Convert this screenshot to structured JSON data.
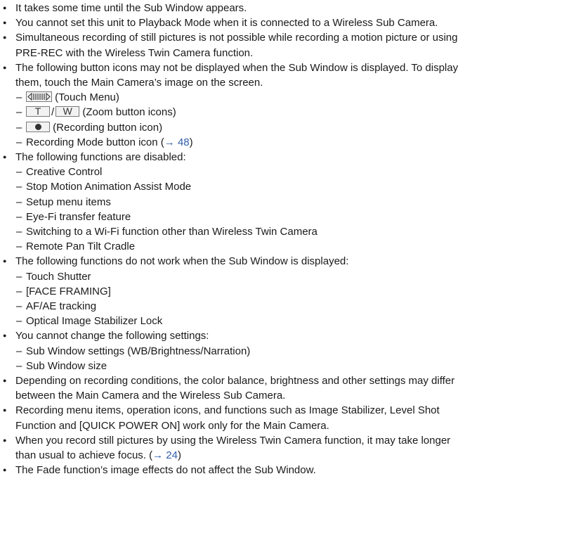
{
  "bullets": [
    {
      "text": "It takes some time until the Sub Window appears."
    },
    {
      "text": "You cannot set this unit to Playback Mode when it is connected to a Wireless Sub Camera."
    },
    {
      "line1": "Simultaneous recording of still pictures is not possible while recording a motion picture or using",
      "line2": "PRE-REC with the Wireless Twin Camera function."
    },
    {
      "line1": "The following button icons may not be displayed when the Sub Window is displayed. To display",
      "line2": "them, touch the Main Camera’s image on the screen."
    },
    {
      "text": "The following functions are disabled:"
    },
    {
      "text": "The following functions do not work when the Sub Window is displayed:"
    },
    {
      "text": "You cannot change the following settings:"
    },
    {
      "line1": "Depending on recording conditions, the color balance, brightness and other settings may differ",
      "line2": "between the Main Camera and the Wireless Sub Camera."
    },
    {
      "line1": "Recording menu items, operation icons, and functions such as Image Stabilizer, Level Shot",
      "line2": "Function and [QUICK POWER ON] work only for the Main Camera."
    },
    {
      "line1": "When you record still pictures by using the Wireless Twin Camera function, it may take longer",
      "line2": "than usual to achieve focus. (",
      "ref": "→ 24",
      "after": ")"
    },
    {
      "text": "The Fade function’s image effects do not affect the Sub Window."
    }
  ],
  "button_icons": {
    "touch_menu_label": "(Touch Menu)",
    "zoom_t": "T",
    "slash": "/",
    "zoom_w": "W",
    "zoom_label": "(Zoom button icons)",
    "recording_label": "(Recording button icon)",
    "rec_mode_text": "Recording Mode button icon (",
    "rec_mode_ref": "→ 48",
    "rec_mode_after": ")"
  },
  "disabled_functions": [
    "Creative Control",
    "Stop Motion Animation Assist Mode",
    "Setup menu items",
    "Eye-Fi transfer feature",
    "Switching to a Wi-Fi function other than Wireless Twin Camera",
    "Remote Pan Tilt Cradle"
  ],
  "not_working_functions": [
    "Touch Shutter",
    "[FACE FRAMING]",
    "AF/AE tracking",
    "Optical Image Stabilizer Lock"
  ],
  "unchangeable_settings": [
    "Sub Window settings (WB/Brightness/Narration)",
    "Sub Window size"
  ],
  "colors": {
    "text": "#1a1a1a",
    "link": "#2f5faa",
    "icon_border": "#7a7a7a",
    "icon_fill": "#f2f2f2"
  },
  "icon_names": {
    "bullet": "bullet-dot-icon",
    "arrow": "arrow-right-icon",
    "touch_menu": "touch-menu-icon",
    "recording": "recording-button-icon"
  }
}
